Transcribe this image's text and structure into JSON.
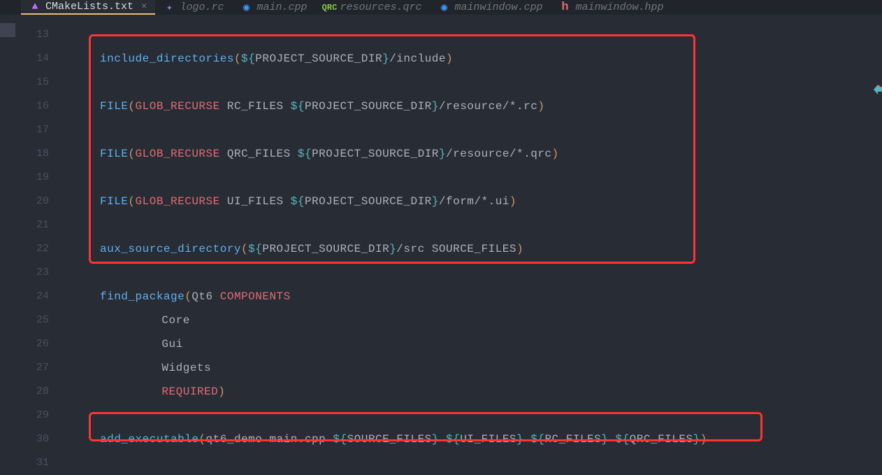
{
  "tabs": [
    {
      "label": "CMakeLists.txt",
      "icon": "cmake",
      "icon_char": "▲",
      "active": true
    },
    {
      "label": "logo.rc",
      "icon": "vs",
      "icon_char": "✦",
      "active": false
    },
    {
      "label": "main.cpp",
      "icon": "cpp",
      "icon_char": "◉",
      "active": false
    },
    {
      "label": "resources.qrc",
      "icon": "qrc",
      "icon_char": "QRC",
      "active": false
    },
    {
      "label": "mainwindow.cpp",
      "icon": "cpp",
      "icon_char": "◉",
      "active": false
    },
    {
      "label": "mainwindow.hpp",
      "icon": "hpp",
      "icon_char": "h",
      "active": false
    }
  ],
  "line_start": 13,
  "line_end": 31,
  "code": {
    "l14": {
      "func": "include_directories",
      "var_open": "${",
      "var": "PROJECT_SOURCE_DIR",
      "var_close": "}",
      "path": "/include"
    },
    "l16": {
      "func": "FILE",
      "kw": "GLOB_RECURSE",
      "name": " RC_FILES ",
      "var_open": "${",
      "var": "PROJECT_SOURCE_DIR",
      "var_close": "}",
      "path": "/resource/*.rc"
    },
    "l18": {
      "func": "FILE",
      "kw": "GLOB_RECURSE",
      "name": " QRC_FILES ",
      "var_open": "${",
      "var": "PROJECT_SOURCE_DIR",
      "var_close": "}",
      "path": "/resource/*.qrc"
    },
    "l20": {
      "func": "FILE",
      "kw": "GLOB_RECURSE",
      "name": " UI_FILES ",
      "var_open": "${",
      "var": "PROJECT_SOURCE_DIR",
      "var_close": "}",
      "path": "/form/*.ui"
    },
    "l22": {
      "func": "aux_source_directory",
      "var_open": "${",
      "var": "PROJECT_SOURCE_DIR",
      "var_close": "}",
      "path": "/src SOURCE_FILES"
    },
    "l24": {
      "func": "find_package",
      "arg1": "Qt6 ",
      "kw": "COMPONENTS"
    },
    "l25": {
      "text": "Core"
    },
    "l26": {
      "text": "Gui"
    },
    "l27": {
      "text": "Widgets"
    },
    "l28": {
      "kw": "REQUIRED"
    },
    "l30": {
      "func": "add_executable",
      "args_pre": "qt6_demo main.cpp ",
      "v1o": "${",
      "v1": "SOURCE_FILES",
      "v1c": "}",
      "v2o": "${",
      "v2": "UI_FILES",
      "v2c": "}",
      "v3o": "${",
      "v3": "RC_FILES",
      "v3c": "}",
      "v4o": "${",
      "v4": "QRC_FILES",
      "v4c": "}"
    }
  }
}
